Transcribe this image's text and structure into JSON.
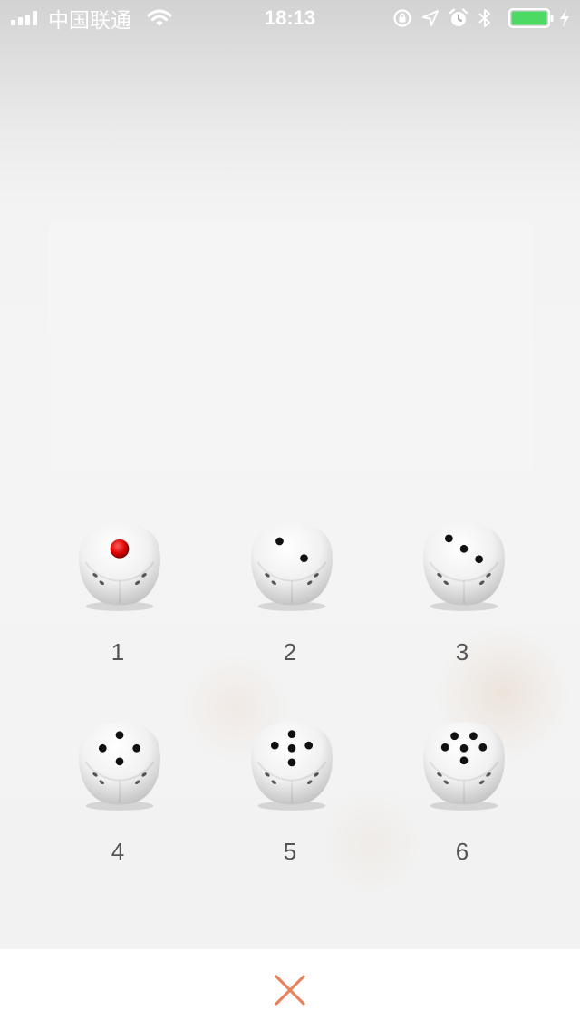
{
  "status_bar": {
    "carrier": "中国联通",
    "time": "18:13",
    "icons": [
      "signal-icon",
      "wifi-icon",
      "orientation-lock-icon",
      "location-icon",
      "alarm-icon",
      "bluetooth-icon",
      "battery-icon",
      "charging-icon"
    ],
    "battery_color": "#4cd964"
  },
  "dice": [
    {
      "label": "1",
      "value": 1
    },
    {
      "label": "2",
      "value": 2
    },
    {
      "label": "3",
      "value": 3
    },
    {
      "label": "4",
      "value": 4
    },
    {
      "label": "5",
      "value": 5
    },
    {
      "label": "6",
      "value": 6
    }
  ],
  "bottom_bar": {
    "close_icon": "close-icon",
    "close_color": "#e8825a"
  }
}
